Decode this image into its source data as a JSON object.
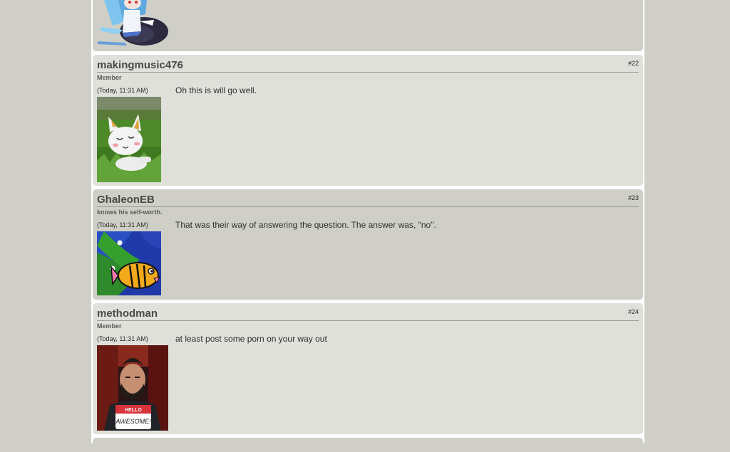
{
  "posts": [
    {
      "number": "#22",
      "username": "makingmusic476",
      "user_title": "Member",
      "timestamp": "(Today, 11:31 AM)",
      "message": "Oh this is will go well."
    },
    {
      "number": "#23",
      "username": "GhaleonEB",
      "user_title": "knows his self-worth.",
      "timestamp": "(Today, 11:31 AM)",
      "message": "That was their way of answering the question. The answer was, \"no\"."
    },
    {
      "number": "#24",
      "username": "methodman",
      "user_title": "Member",
      "timestamp": "(Today, 11:31 AM)",
      "message": "at least post some porn on your way out"
    }
  ],
  "avatar_badge": {
    "line1": "HELLO",
    "line2": "AWESOME!"
  }
}
